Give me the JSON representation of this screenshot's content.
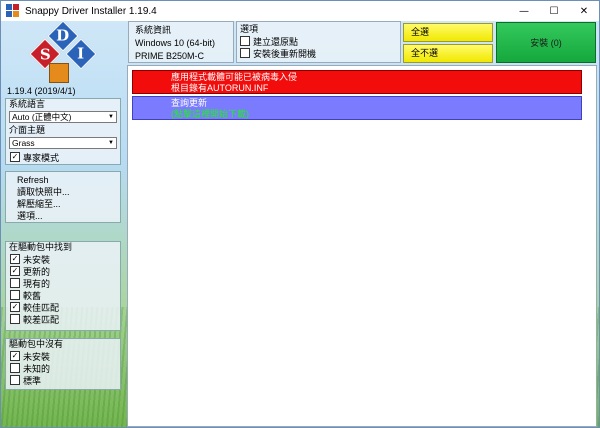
{
  "window": {
    "title": "Snappy Driver Installer 1.19.4",
    "controls": {
      "minimize": "—",
      "maximize": "☐",
      "close": "✕"
    }
  },
  "logo": {
    "letters": [
      "D",
      "S",
      "I"
    ],
    "colors": [
      "#2a63b8",
      "#c8202a",
      "#2a63b8",
      "#e58b1c"
    ]
  },
  "version": "1.19.4 (2019/4/1)",
  "left_panel": {
    "language": {
      "label": "系統語言",
      "value": "Auto (正體中文)"
    },
    "theme": {
      "label": "介面主題",
      "value": "Grass"
    },
    "expert_mode": {
      "label": "專家模式",
      "checked": true
    },
    "actions": [
      "Refresh",
      "讀取快照中...",
      "解壓縮至...",
      "選項..."
    ],
    "found_in_pack": {
      "label": "在驅動包中找到",
      "items": [
        {
          "label": "未安裝",
          "checked": true
        },
        {
          "label": "更新的",
          "checked": true
        },
        {
          "label": "現有的",
          "checked": false
        },
        {
          "label": "較舊",
          "checked": false
        },
        {
          "label": "較佳匹配",
          "checked": true
        },
        {
          "label": "較差匹配",
          "checked": false
        }
      ]
    },
    "not_in_pack": {
      "label": "驅動包中沒有",
      "items": [
        {
          "label": "未安裝",
          "checked": true
        },
        {
          "label": "未知的",
          "checked": false
        },
        {
          "label": "標準",
          "checked": false
        }
      ]
    }
  },
  "sysinfo": {
    "heading": "系統資訊",
    "os": "Windows 10 (64-bit)",
    "board": "PRIME B250M-C"
  },
  "options": {
    "heading": "選項",
    "items": [
      {
        "label": "建立還原點",
        "checked": false
      },
      {
        "label": "安裝後重新開機",
        "checked": false
      }
    ]
  },
  "buttons": {
    "select_all": "全選",
    "select_none": "全不選",
    "install": "安裝 (0)"
  },
  "main_list": {
    "rows": [
      {
        "line1": "應用程式載體可能已被病毒入侵",
        "line2": "根目錄有AUTORUN.INF",
        "color": "#f20c0c"
      },
      {
        "line1": "查詢更新",
        "line2": "(點擊這裡開始下載)",
        "color": "#7b7bff"
      }
    ]
  }
}
